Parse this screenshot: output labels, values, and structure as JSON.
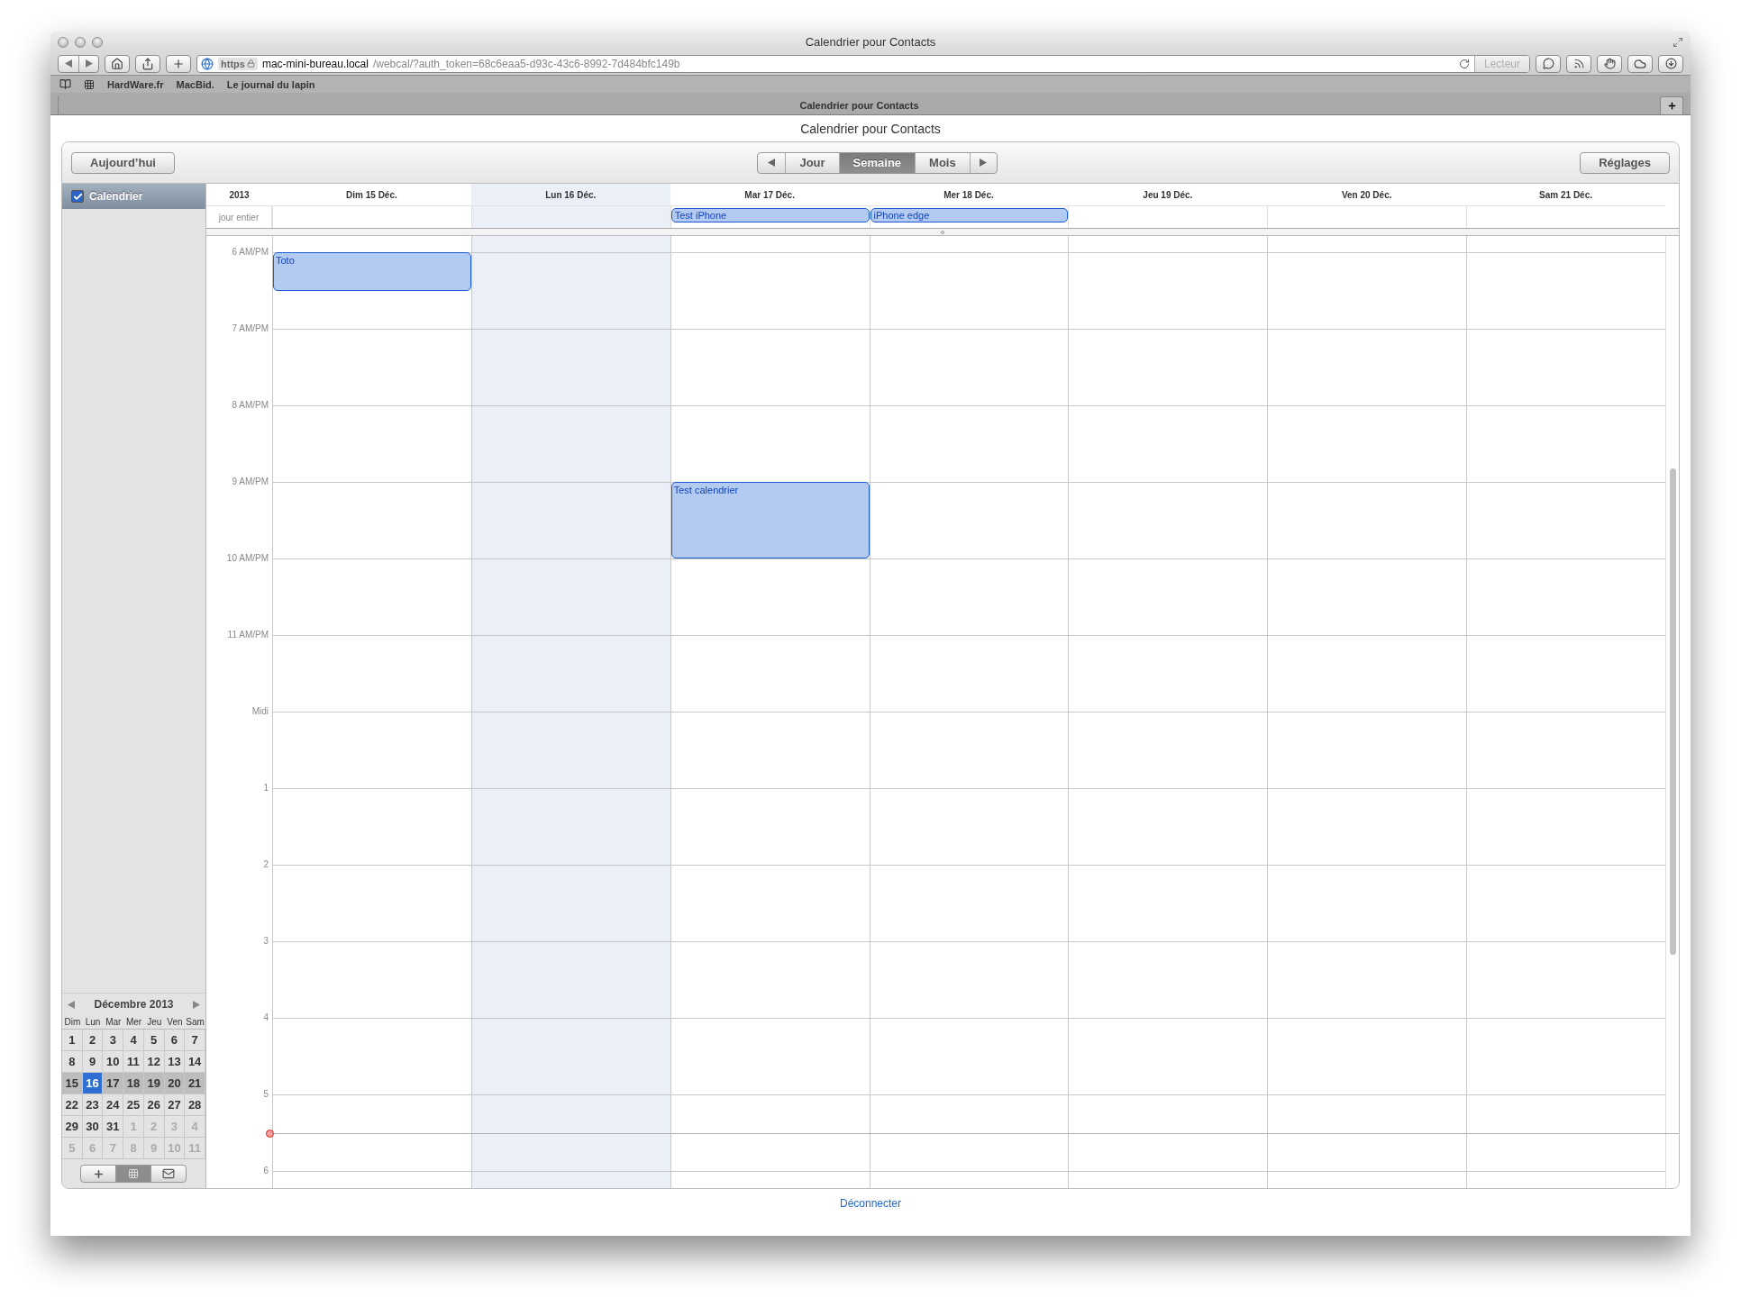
{
  "window": {
    "title": "Calendrier pour Contacts"
  },
  "toolbar": {
    "protocol": "https",
    "url_host": "mac-mini-bureau.local",
    "url_path": "/webcal/?auth_token=68c6eaa5-d93c-43c6-8992-7d484bfc149b",
    "reader_button": {
      "label": "Lecteur",
      "disabled": true
    }
  },
  "bookmarks": [
    "HardWare.fr",
    "MacBid.",
    "Le journal du lapin"
  ],
  "tabs": [
    {
      "label": "Calendrier pour Contacts",
      "selected": true
    }
  ],
  "page": {
    "title": "Calendrier pour Contacts",
    "today_button": "Aujourd’hui",
    "views": [
      {
        "label": "Jour",
        "selected": false
      },
      {
        "label": "Semaine",
        "selected": true
      },
      {
        "label": "Mois",
        "selected": false
      }
    ],
    "settings_button": "Réglages",
    "logout_link": "Déconnecter"
  },
  "sidebar": {
    "calendars": [
      {
        "label": "Calendrier",
        "checked": true,
        "selected": true
      }
    ],
    "mini_calendar": {
      "title": "Décembre 2013",
      "weekdays": [
        "Dim",
        "Lun",
        "Mar",
        "Mer",
        "Jeu",
        "Ven",
        "Sam"
      ],
      "weeks": [
        {
          "highlighted": false,
          "days": [
            {
              "label": "1",
              "muted": false,
              "selected": false
            },
            {
              "label": "2",
              "muted": false,
              "selected": false
            },
            {
              "label": "3",
              "muted": false,
              "selected": false
            },
            {
              "label": "4",
              "muted": false,
              "selected": false
            },
            {
              "label": "5",
              "muted": false,
              "selected": false
            },
            {
              "label": "6",
              "muted": false,
              "selected": false
            },
            {
              "label": "7",
              "muted": false,
              "selected": false
            }
          ]
        },
        {
          "highlighted": false,
          "days": [
            {
              "label": "8",
              "muted": false,
              "selected": false
            },
            {
              "label": "9",
              "muted": false,
              "selected": false
            },
            {
              "label": "10",
              "muted": false,
              "selected": false
            },
            {
              "label": "11",
              "muted": false,
              "selected": false
            },
            {
              "label": "12",
              "muted": false,
              "selected": false
            },
            {
              "label": "13",
              "muted": false,
              "selected": false
            },
            {
              "label": "14",
              "muted": false,
              "selected": false
            }
          ]
        },
        {
          "highlighted": true,
          "days": [
            {
              "label": "15",
              "muted": false,
              "selected": false
            },
            {
              "label": "16",
              "muted": false,
              "selected": true
            },
            {
              "label": "17",
              "muted": false,
              "selected": false
            },
            {
              "label": "18",
              "muted": false,
              "selected": false
            },
            {
              "label": "19",
              "muted": false,
              "selected": false
            },
            {
              "label": "20",
              "muted": false,
              "selected": false
            },
            {
              "label": "21",
              "muted": false,
              "selected": false
            }
          ]
        },
        {
          "highlighted": false,
          "days": [
            {
              "label": "22",
              "muted": false,
              "selected": false
            },
            {
              "label": "23",
              "muted": false,
              "selected": false
            },
            {
              "label": "24",
              "muted": false,
              "selected": false
            },
            {
              "label": "25",
              "muted": false,
              "selected": false
            },
            {
              "label": "26",
              "muted": false,
              "selected": false
            },
            {
              "label": "27",
              "muted": false,
              "selected": false
            },
            {
              "label": "28",
              "muted": false,
              "selected": false
            }
          ]
        },
        {
          "highlighted": false,
          "days": [
            {
              "label": "29",
              "muted": false,
              "selected": false
            },
            {
              "label": "30",
              "muted": false,
              "selected": false
            },
            {
              "label": "31",
              "muted": false,
              "selected": false
            },
            {
              "label": "1",
              "muted": true,
              "selected": false
            },
            {
              "label": "2",
              "muted": true,
              "selected": false
            },
            {
              "label": "3",
              "muted": true,
              "selected": false
            },
            {
              "label": "4",
              "muted": true,
              "selected": false
            }
          ]
        },
        {
          "highlighted": false,
          "days": [
            {
              "label": "5",
              "muted": true,
              "selected": false
            },
            {
              "label": "6",
              "muted": true,
              "selected": false
            },
            {
              "label": "7",
              "muted": true,
              "selected": false
            },
            {
              "label": "8",
              "muted": true,
              "selected": false
            },
            {
              "label": "9",
              "muted": true,
              "selected": false
            },
            {
              "label": "10",
              "muted": true,
              "selected": false
            },
            {
              "label": "11",
              "muted": true,
              "selected": false
            }
          ]
        }
      ]
    },
    "bottom_buttons": [
      {
        "kind": "add",
        "selected": false
      },
      {
        "kind": "calendar",
        "selected": true
      },
      {
        "kind": "mail",
        "selected": false
      }
    ]
  },
  "week": {
    "year": "2013",
    "all_day_label": "jour entier",
    "hours": [
      "6 AM/PM",
      "7 AM/PM",
      "8 AM/PM",
      "9 AM/PM",
      "10 AM/PM",
      "11 AM/PM",
      "Midi",
      "1",
      "2",
      "3",
      "4",
      "5",
      "6"
    ],
    "days": [
      {
        "label": "Dim 15 Déc.",
        "selected": false,
        "slots": [
          {
            "kind": "half",
            "title": "Toto"
          }
        ]
      },
      {
        "label": "Lun 16 Déc.",
        "selected": true
      },
      {
        "label": "Mar 17 Déc.",
        "selected": false,
        "all_day": [
          {
            "title": "Test iPhone"
          }
        ],
        "slots": [
          {
            "kind": "empty"
          },
          {
            "kind": "empty"
          },
          {
            "kind": "empty"
          },
          {
            "kind": "hour",
            "title": "Test calendrier"
          }
        ]
      },
      {
        "label": "Mer 18 Déc.",
        "selected": false,
        "all_day": [
          {
            "title": "iPhone edge"
          }
        ]
      },
      {
        "label": "Jeu 19 Déc.",
        "selected": false
      },
      {
        "label": "Ven 20 Déc.",
        "selected": false
      },
      {
        "label": "Sam 21 Déc.",
        "selected": false
      }
    ]
  }
}
